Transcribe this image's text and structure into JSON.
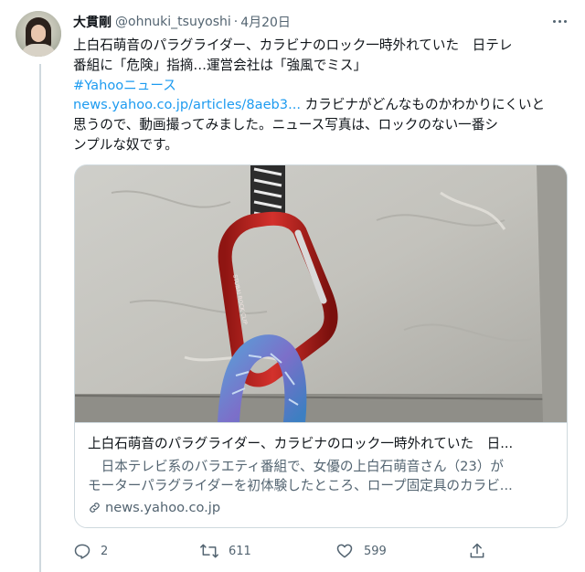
{
  "tweet": {
    "author_name": "大貫剛",
    "author_handle": "@ohnuki_tsuyoshi",
    "separator": "·",
    "date": "4月20日",
    "text_lines": [
      "上白石萌音のパラグライダー、カラビナのロック一時外れていた　日テレ",
      "番組に「危険」指摘…運営会社は「強風でミス」"
    ],
    "hashtag": "#Yahooニュース",
    "url_text": "news.yahoo.co.jp/articles/8aeb3...",
    "comment_lines": [
      " カラビナがどんなものかわかりにくいと",
      "思うので、動画撮ってみました。ニュース写真は、ロックのない一番シ",
      "ンプルな奴です。"
    ]
  },
  "card": {
    "title": "上白石萌音のパラグライダー、カラビナのロック一時外れていた　日...",
    "desc_lines": [
      "　日本テレビ系のバラエティ番組で、女優の上白石萌音さん（23）が",
      "モーターパラグライダーを初体験したところ、ロープ固定具のカラビ..."
    ],
    "domain": "news.yahoo.co.jp",
    "image_alt_text": "STUBAI ROCK CLIP"
  },
  "actions": {
    "reply_count": "2",
    "retweet_count": "611",
    "like_count": "599"
  },
  "icons": [
    "more-icon",
    "reply-icon",
    "retweet-icon",
    "like-icon",
    "share-icon",
    "link-icon"
  ],
  "colors": {
    "link": "#1d9bf0",
    "secondary": "#536471",
    "border": "#cfd9de",
    "carabiner": "#c8231f"
  }
}
